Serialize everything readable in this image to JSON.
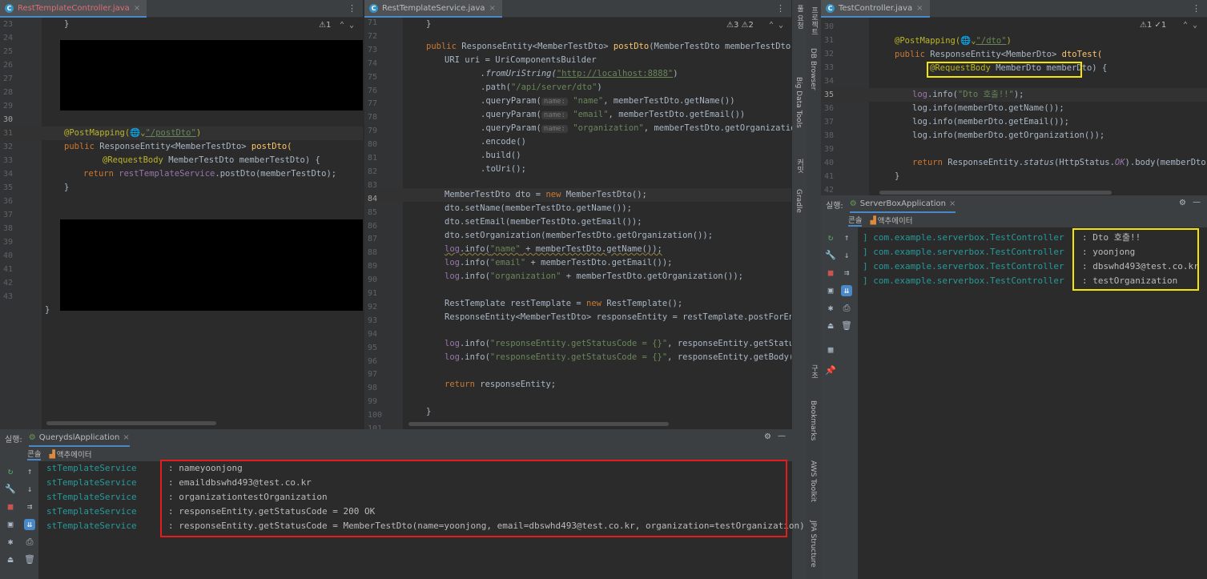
{
  "left_editor": {
    "tab": "RestTemplateController.java",
    "warnings": "⚠1",
    "lines": [
      "23",
      "24",
      "25",
      "26",
      "27",
      "28",
      "29",
      "30",
      "31",
      "32",
      "33",
      "34",
      "35",
      "36",
      "37",
      "38",
      "39",
      "40",
      "41",
      "42",
      "43"
    ],
    "code": {
      "l23": "}",
      "l30_anno": "@PostMapping(",
      "l30_path": "\"/postDto\"",
      "l30_end": ")",
      "l31_a": "public ",
      "l31_b": "ResponseEntity<MemberTestDto> ",
      "l31_c": "postDto(",
      "l32_a": "@RequestBody ",
      "l32_b": "MemberTestDto memberTestDto) {",
      "l33_a": "return ",
      "l33_b": "restTemplateService",
      "l33_c": ".postDto(memberTestDto);",
      "l34": "}",
      "l42": "}"
    }
  },
  "middle_editor": {
    "tab": "RestTemplateService.java",
    "warnings": "⚠3  ⚠2",
    "lines": [
      "71",
      "72",
      "73",
      "74",
      "75",
      "76",
      "77",
      "78",
      "79",
      "80",
      "81",
      "82",
      "83",
      "84",
      "85",
      "86",
      "87",
      "88",
      "89",
      "90",
      "91",
      "92",
      "93",
      "94",
      "95",
      "96",
      "97",
      "98",
      "99",
      "100",
      "101"
    ],
    "code": {
      "l72": "}",
      "l73_a": "public ",
      "l73_b": "ResponseEntity<MemberTestDto> ",
      "l73_c": "postDto",
      "l73_d": "(MemberTestDto memberTestDto) {",
      "l74": "URI uri = UriComponentsBuilder",
      "l75_a": ".fromUriString(",
      "l75_b": "\"http://localhost:8888\"",
      "l75_c": ")",
      "l76_a": ".path(",
      "l76_b": "\"/api/server/dto\"",
      "l76_c": ")",
      "l77_a": ".queryParam(",
      "l77_h": "name:",
      "l77_b": "\"name\"",
      "l77_c": ", memberTestDto.getName())",
      "l78_a": ".queryParam(",
      "l78_h": "name:",
      "l78_b": "\"email\"",
      "l78_c": ", memberTestDto.getEmail())",
      "l79_a": ".queryParam(",
      "l79_h": "name:",
      "l79_b": "\"organization\"",
      "l79_c": ", memberTestDto.getOrganization())",
      "l80": ".encode()",
      "l81": ".build()",
      "l82": ".toUri();",
      "l84_a": "MemberTestDto dto = ",
      "l84_b": "new ",
      "l84_c": "MemberTestDto();",
      "l85": "dto.setName(memberTestDto.getName());",
      "l86": "dto.setEmail(memberTestDto.getEmail());",
      "l87": "dto.setOrganization(memberTestDto.getOrganization());",
      "l88_a": "log",
      "l88_b": ".info(",
      "l88_c": "\"name\"",
      "l88_d": " + memberTestDto.getName());",
      "l89_a": "log",
      "l89_b": ".info(",
      "l89_c": "\"email\"",
      "l89_d": " + memberTestDto.getEmail());",
      "l90_a": "log",
      "l90_b": ".info(",
      "l90_c": "\"organization\"",
      "l90_d": " + memberTestDto.getOrganization());",
      "l92_a": "RestTemplate restTemplate = ",
      "l92_b": "new ",
      "l92_c": "RestTemplate();",
      "l93": "ResponseEntity<MemberTestDto> responseEntity = restTemplate.postForEntity(uri,",
      "l95_a": "log",
      "l95_b": ".info(",
      "l95_c": "\"responseEntity.getStatusCode = {}\"",
      "l95_d": ", responseEntity.getStatusCode());",
      "l96_a": "log",
      "l96_b": ".info(",
      "l96_c": "\"responseEntity.getStatusCode = {}\"",
      "l96_d": ", responseEntity.getBody());",
      "l98_a": "return ",
      "l98_b": "responseEntity;",
      "l100": "}"
    }
  },
  "right_editor": {
    "tab": "TestController.java",
    "warnings": "⚠1  ✓1",
    "lines": [
      "30",
      "31",
      "32",
      "33",
      "34",
      "35",
      "36",
      "37",
      "38",
      "39",
      "40",
      "41",
      "42"
    ],
    "code": {
      "l31_a": "@PostMapping(",
      "l31_b": "\"/dto\"",
      "l31_c": ")",
      "l32_a": "public ",
      "l32_b": "ResponseEntity<MemberDto> ",
      "l32_c": "dtoTest(",
      "l33_a": "@RequestBody ",
      "l33_b": "MemberDto memberDto)",
      "l33_c": " {",
      "l35_a": "log",
      "l35_b": ".info(",
      "l35_c": "\"Dto 호출!!\"",
      "l35_d": ");",
      "l36": "log.info(memberDto.getName());",
      "l37": "log.info(memberDto.getEmail());",
      "l38": "log.info(memberDto.getOrganization());",
      "l40_a": "return ",
      "l40_b": "ResponseEntity.",
      "l40_c": "status",
      "l40_d": "(HttpStatus.",
      "l40_e": "OK",
      "l40_f": ").body(memberDto);",
      "l41": "}"
    }
  },
  "side_tools": {
    "project": "프로젝트",
    "db_browser": "DB Browser",
    "big_data": "Big Data Tools",
    "gradle": "Gradle",
    "structure": "구조",
    "bookmarks": "Bookmarks",
    "aws": "AWS Toolkit",
    "jpa": "JPA Structure",
    "commit": "커밋",
    "pull": "풀 요청"
  },
  "left_run": {
    "label": "실행:",
    "app": "QuerydslApplication",
    "tab_console": "콘솔",
    "tab_actuator": "액추에이터",
    "rows": [
      {
        "cls": "stTemplateService",
        "msg": ": nameyoonjong"
      },
      {
        "cls": "stTemplateService",
        "msg": ": emaildbswhd493@test.co.kr"
      },
      {
        "cls": "stTemplateService",
        "msg": ": organizationtestOrganization"
      },
      {
        "cls": "stTemplateService",
        "msg": ": responseEntity.getStatusCode = 200 OK"
      },
      {
        "cls": "stTemplateService",
        "msg": ": responseEntity.getStatusCode = MemberTestDto(name=yoonjong, email=dbswhd493@test.co.kr, organization=testOrganization)"
      }
    ]
  },
  "right_run": {
    "label": "실행:",
    "app": "ServerBoxApplication",
    "tab_console": "콘솔",
    "tab_actuator": "액추에이터",
    "rows": [
      {
        "cls": "] com.example.serverbox.TestController",
        "msg": ": Dto 호출!!"
      },
      {
        "cls": "] com.example.serverbox.TestController",
        "msg": ": yoonjong"
      },
      {
        "cls": "] com.example.serverbox.TestController",
        "msg": ": dbswhd493@test.co.kr"
      },
      {
        "cls": "] com.example.serverbox.TestController",
        "msg": ": testOrganization"
      }
    ]
  },
  "colors": {
    "highlight_red": "#e31c1c",
    "highlight_yellow": "#f5e600",
    "accent": "#4a88c7"
  }
}
